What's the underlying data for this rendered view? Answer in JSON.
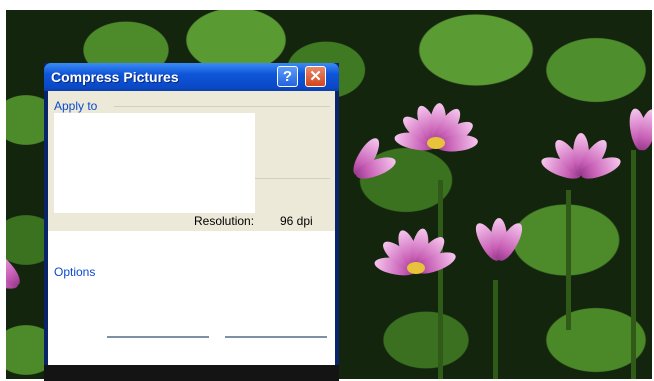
{
  "dialog": {
    "title": "Compress Pictures",
    "help_label": "?",
    "close_label": "✕",
    "apply_to_label": "Apply to",
    "resolution_label": "Resolution:",
    "resolution_value": "96 dpi",
    "options_label": "Options"
  },
  "wallpaper": {
    "flower_color": "#c860b6",
    "leaf_color": "#4c8a2a"
  }
}
